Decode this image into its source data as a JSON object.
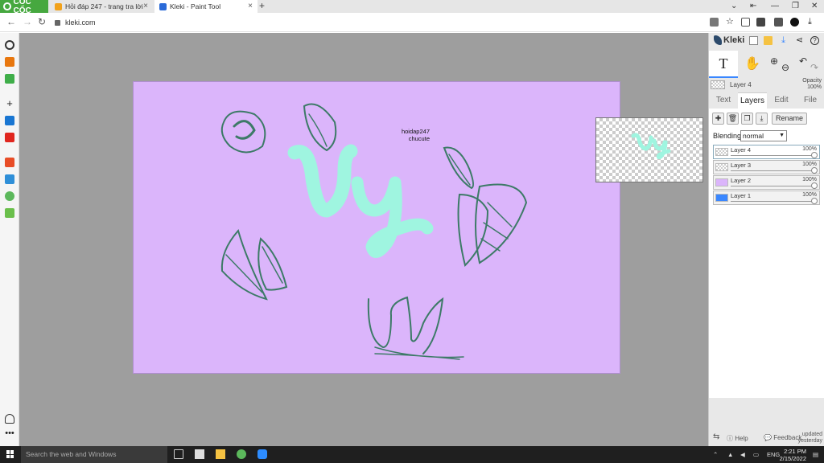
{
  "browser": {
    "brand": "CỐC CỐC",
    "tabs": [
      {
        "title": "Hỏi đáp 247 - trang tra lời"
      },
      {
        "title": "Kleki - Paint Tool"
      }
    ],
    "new_tab": "+",
    "url": "kleki.com"
  },
  "app": {
    "name": "Kleki",
    "current_layer": "Layer 4",
    "opacity_label": "Opacity",
    "opacity_value": "100%",
    "tabs": [
      {
        "label": "Text"
      },
      {
        "label": "Layers"
      },
      {
        "label": "Edit"
      },
      {
        "label": "File"
      }
    ],
    "rename_label": "Rename",
    "blending_label": "Blending",
    "blending_value": "normal",
    "layers": [
      {
        "name": "Layer 4",
        "opacity": "100%"
      },
      {
        "name": "Layer 3",
        "opacity": "100%"
      },
      {
        "name": "Layer 2",
        "opacity": "100%"
      },
      {
        "name": "Layer 1",
        "opacity": "100%"
      }
    ],
    "footer": {
      "help": "Help",
      "feedback": "Feedback",
      "updated_line1": "updated",
      "updated_line2": "yesterday"
    }
  },
  "canvas": {
    "credit_line1": "hoidap247",
    "credit_line2": "chucute",
    "text_art": "Vy"
  },
  "taskbar": {
    "search_placeholder": "Search the web and Windows",
    "lang": "ENG",
    "time": "2:21 PM",
    "date": "2/15/2022"
  },
  "colors": {
    "canvas_bg": "#dbb5fb",
    "lettering": "#9ff5e0",
    "leaf_stroke": "#3d7a67",
    "brand_green": "#46a83f",
    "accent_blue": "#3a87ff"
  }
}
